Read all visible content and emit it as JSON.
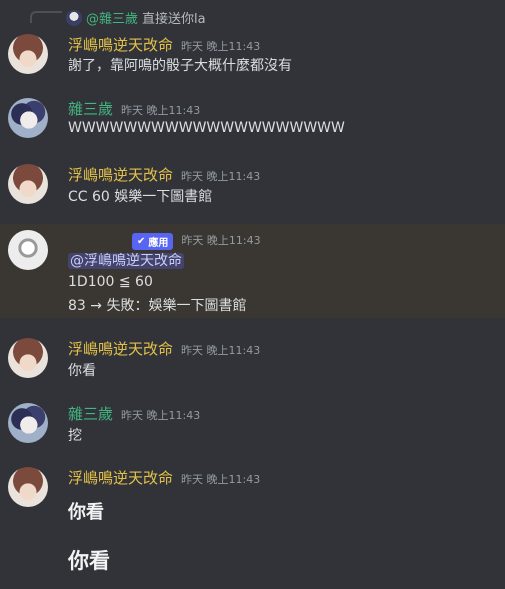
{
  "reply": {
    "name": "@雜三歲",
    "text": "直接送你la"
  },
  "messages": [
    {
      "author": "浮嶋鳴逆天改命",
      "timestamp": "昨天 晚上11:43",
      "text": "謝了，靠阿鳴的骰子大概什麼都沒有"
    },
    {
      "author": "雜三歲",
      "timestamp": "昨天 晚上11:43",
      "text": "WWWWWWWWWWWWWWWWWWWW"
    },
    {
      "author": "浮嶋鳴逆天改命",
      "timestamp": "昨天 晚上11:43",
      "text": "CC 60 娛樂一下圖書館"
    },
    {
      "badge": "應用",
      "timestamp": "昨天 晚上11:43",
      "mention": "@浮嶋鳴逆天改命",
      "line2": "1D100 ≦ 60",
      "line3": "83 → 失敗：娛樂一下圖書館"
    },
    {
      "author": "浮嶋鳴逆天改命",
      "timestamp": "昨天 晚上11:43",
      "text": "你看"
    },
    {
      "author": "雜三歲",
      "timestamp": "昨天 晚上11:43",
      "text": "挖"
    },
    {
      "author": "浮嶋鳴逆天改命",
      "timestamp": "昨天 晚上11:43",
      "text": "你看",
      "text2": "你看"
    }
  ],
  "colors": {
    "background": "#313338",
    "highlight": "#3a3631",
    "name_yellow": "#e3c24a",
    "name_green": "#43b581",
    "badge": "#5865f2"
  }
}
